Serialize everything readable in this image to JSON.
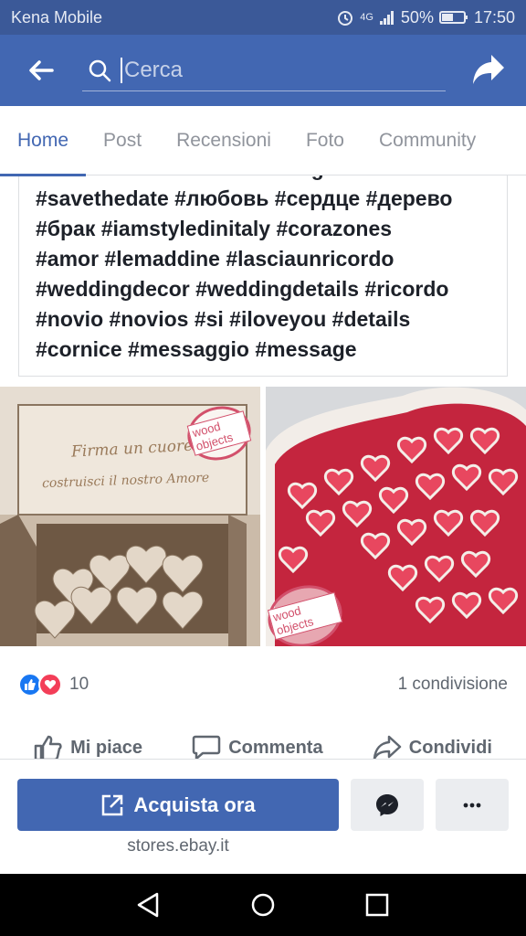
{
  "status_bar": {
    "carrier": "Kena Mobile",
    "network": "4G",
    "battery": "50%",
    "time": "17:50"
  },
  "header": {
    "search_placeholder": "Cerca",
    "icons": [
      "back-arrow-icon",
      "search-icon",
      "share-icon"
    ]
  },
  "tabs": [
    {
      "label": "Home",
      "active": true
    },
    {
      "label": "Post",
      "active": false
    },
    {
      "label": "Recensioni",
      "active": false
    },
    {
      "label": "Foto",
      "active": false
    },
    {
      "label": "Community",
      "active": false
    }
  ],
  "post": {
    "text_lines": [
      "#love #matrimonio #wedding",
      "#savethedate #любовь #сердце #дерево",
      "#брак #iamstyledinitaly #corazones",
      "#amor #lemaddine #lasciaunricordo",
      "#weddingdecor  #weddingdetails #ricordo",
      "#novio #novios #si #iloveyou #details",
      "#cornice #messaggio #message"
    ],
    "photo_one": {
      "engraving_line1": "Firma un cuore,",
      "engraving_line2": "costruisci il nostro Amore",
      "stamp": "wood objects"
    },
    "photo_two": {
      "stamp": "wood objects"
    },
    "reaction_count": "10",
    "share_count": "1 condivisione",
    "actions": {
      "like": "Mi piace",
      "comment": "Commenta",
      "share": "Condividi"
    }
  },
  "cta": {
    "buy_label": "Acquista ora",
    "store_link": "stores.ebay.it"
  },
  "colors": {
    "facebook_blue": "#4267b2",
    "status_bar": "#3b5998",
    "like_blue": "#1877f2",
    "love_red": "#f33e58"
  }
}
